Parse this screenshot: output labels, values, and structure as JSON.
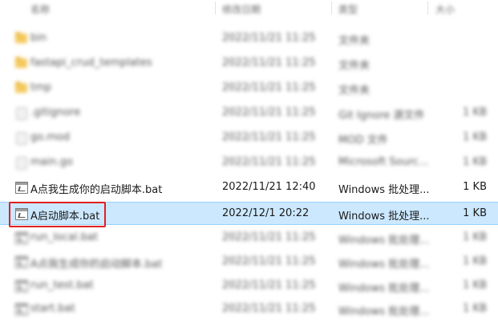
{
  "header": {
    "name_label": "名称",
    "date_label": "修改日期",
    "type_label": "类型",
    "size_label": "大小"
  },
  "rows": [
    {
      "name": "bin",
      "date": "2022/11/21 11:25",
      "type": "文件夹",
      "size": "",
      "icon": "folder-icon",
      "blurred": true
    },
    {
      "name": "fastapi_crud_templates",
      "date": "2022/11/21 11:25",
      "type": "文件夹",
      "size": "",
      "icon": "folder-icon",
      "blurred": true
    },
    {
      "name": "tmp",
      "date": "2022/11/21 11:25",
      "type": "文件夹",
      "size": "",
      "icon": "folder-icon",
      "blurred": true
    },
    {
      "name": ".gitignore",
      "date": "2022/11/21 11:25",
      "type": "Git Ignore 源文件",
      "size": "1 KB",
      "icon": "file-icon",
      "blurred": true
    },
    {
      "name": "go.mod",
      "date": "2022/11/21 11:25",
      "type": "MOD 文件",
      "size": "1 KB",
      "icon": "file-icon",
      "blurred": true
    },
    {
      "name": "main.go",
      "date": "2022/11/21 11:25",
      "type": "Microsoft Sourc...",
      "size": "1 KB",
      "icon": "file-icon",
      "blurred": true
    },
    {
      "name": "A点我生成你的启动脚本.bat",
      "date": "2022/11/21 12:40",
      "type": "Windows 批处理...",
      "size": "1 KB",
      "icon": "bat-file-icon",
      "blurred": false
    },
    {
      "name": "A启动脚本.bat",
      "date": "2022/12/1 20:22",
      "type": "Windows 批处理...",
      "size": "1 KB",
      "icon": "bat-file-icon",
      "blurred": false,
      "selected": true
    },
    {
      "name": "run_local.bat",
      "date": "2022/11/21 11:25",
      "type": "Windows 批处理...",
      "size": "1 KB",
      "icon": "bat-file-icon",
      "blurred": true
    },
    {
      "name": "A点我生成你的启动脚本.bat",
      "date": "2022/11/21 11:25",
      "type": "Windows 批处理...",
      "size": "1 KB",
      "icon": "bat-file-icon",
      "blurred": true
    },
    {
      "name": "run_test.bat",
      "date": "2022/11/21 11:25",
      "type": "Windows 批处理...",
      "size": "1 KB",
      "icon": "bat-file-icon",
      "blurred": true
    },
    {
      "name": "start.bat",
      "date": "2022/11/21 11:25",
      "type": "Windows 批处理...",
      "size": "1 KB",
      "icon": "bat-file-icon",
      "blurred": true
    }
  ],
  "colors": {
    "selection_bg": "#cce8ff",
    "selection_border": "#99d1ff",
    "highlight_box": "#e02020",
    "folder": "#f4c95d"
  }
}
